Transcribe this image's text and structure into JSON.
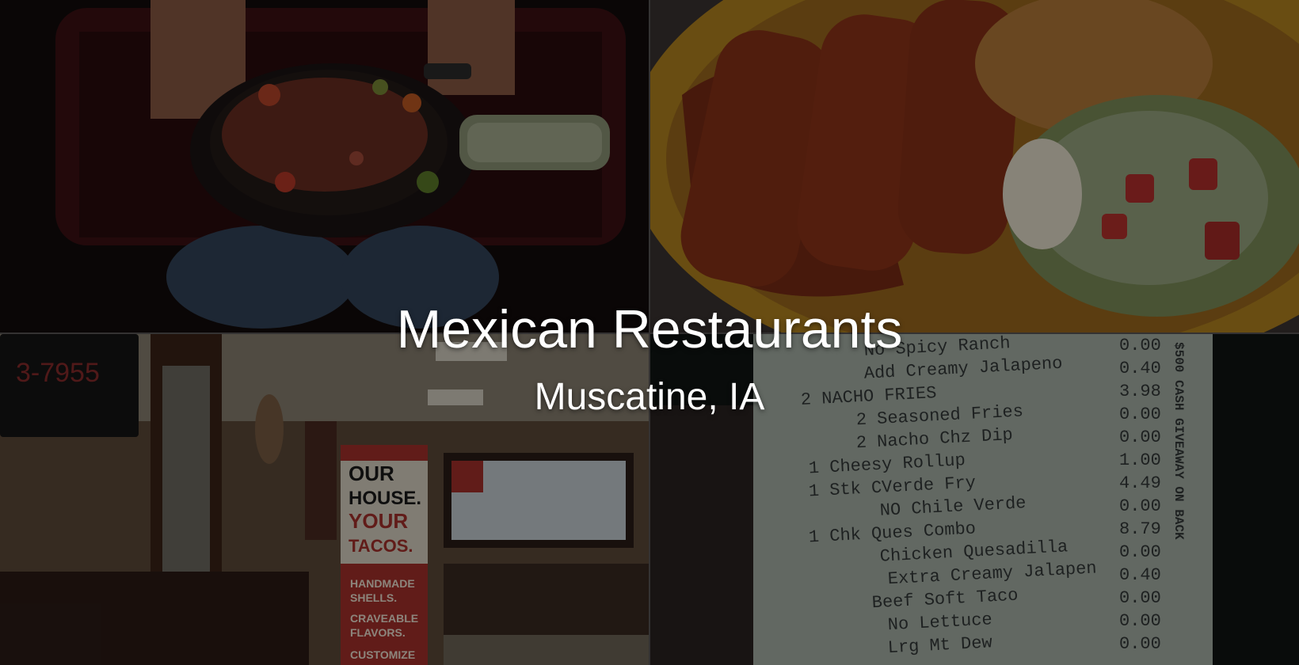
{
  "hero": {
    "title": "Mexican Restaurants",
    "subtitle": "Muscatine, IA"
  },
  "collage": {
    "photos": [
      {
        "name": "fajita-skillet-photo",
        "colors": {
          "base": "#1a0f0f",
          "accent": "#7a1f1f"
        }
      },
      {
        "name": "enchilada-plate-photo",
        "colors": {
          "base": "#b98a22",
          "accent": "#9a3a1c"
        }
      },
      {
        "name": "restaurant-interior-photo",
        "colors": {
          "base": "#5a4736",
          "accent": "#b23a32"
        }
      },
      {
        "name": "receipt-photo",
        "colors": {
          "base": "#111514",
          "accent": "#b7c1b7"
        }
      }
    ],
    "interior_sign": {
      "line1": "OUR",
      "line2": "HOUSE.",
      "line3": "YOUR",
      "line4": "TACOS.",
      "line5": "HANDMADE",
      "line6": "SHELLS.",
      "line7": "CRAVEABLE",
      "line8": "FLAVORS.",
      "line9": "CUSTOMIZE"
    },
    "tv_text": "3-7955",
    "receipt": {
      "lines": [
        {
          "text": "No Spicy Ranch",
          "price": "0.00"
        },
        {
          "text": "Add Creamy Jalapeno",
          "price": "0.40"
        },
        {
          "text": "2 NACHO FRIES",
          "price": "3.98"
        },
        {
          "text": "2 Seasoned Fries",
          "price": "0.00"
        },
        {
          "text": "2 Nacho Chz Dip",
          "price": "0.00"
        },
        {
          "text": "1 Cheesy Rollup",
          "price": "1.00"
        },
        {
          "text": "1 Stk CVerde Fry",
          "price": "4.49"
        },
        {
          "text": "NO Chile Verde",
          "price": "0.00"
        },
        {
          "text": "1 Chk Ques Combo",
          "price": "8.79"
        },
        {
          "text": "Chicken Quesadilla",
          "price": "0.00"
        },
        {
          "text": "Extra Creamy Jalapen",
          "price": "0.40"
        },
        {
          "text": "Beef Soft Taco",
          "price": "0.00"
        },
        {
          "text": "No Lettuce",
          "price": "0.00"
        },
        {
          "text": "Lrg Mt Dew",
          "price": "0.00"
        }
      ],
      "side_text": "$500 CASH GIVEAWAY ON BACK"
    }
  }
}
